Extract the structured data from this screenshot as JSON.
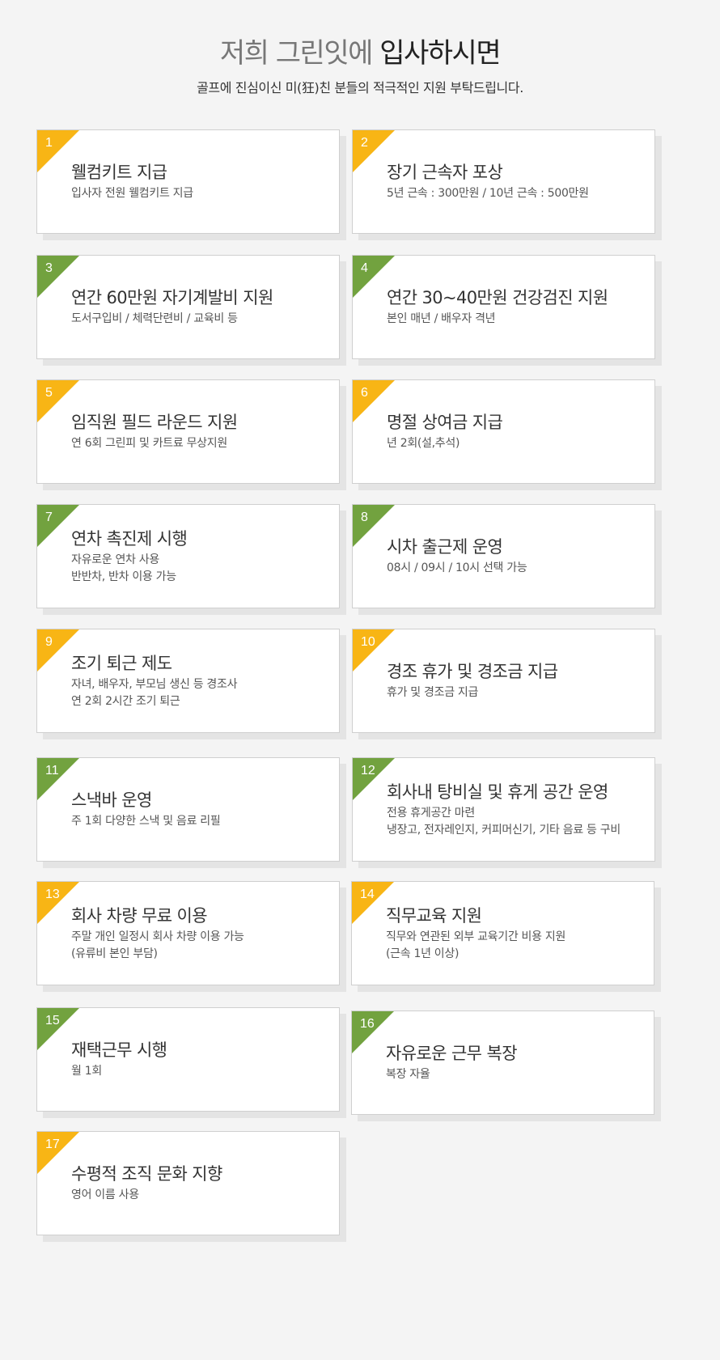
{
  "header": {
    "title_light": "저희 그린잇에",
    "title_bold": "입사하시면",
    "subtitle": "골프에 진심이신 미(狂)친 분들의 적극적인 지원 부탁드립니다."
  },
  "colors": {
    "yellow": "#f8b515",
    "green": "#72a23f"
  },
  "benefits": [
    {
      "num": "1",
      "color": "yellow",
      "title": "웰컴키트 지급",
      "lines": [
        "입사자 전원 웰컴키트 지급"
      ]
    },
    {
      "num": "2",
      "color": "yellow",
      "title": "장기 근속자 포상",
      "lines": [
        "5년 근속 : 300만원 / 10년 근속 : 500만원"
      ]
    },
    {
      "num": "3",
      "color": "green",
      "title": "연간 60만원 자기계발비 지원",
      "lines": [
        "도서구입비 / 체력단련비 / 교육비 등"
      ]
    },
    {
      "num": "4",
      "color": "green",
      "title": "연간 30~40만원 건강검진 지원",
      "lines": [
        "본인 매년 / 배우자 격년"
      ]
    },
    {
      "num": "5",
      "color": "yellow",
      "title": "임직원 필드 라운드 지원",
      "lines": [
        " 연 6회 그린피 및 카트료 무상지원"
      ]
    },
    {
      "num": "6",
      "color": "yellow",
      "title": "명절 상여금 지급",
      "lines": [
        "년 2회(설,추석)"
      ]
    },
    {
      "num": "7",
      "color": "green",
      "title": "연차 촉진제 시행",
      "lines": [
        "자유로운 연차 사용",
        "반반차, 반차 이용 가능"
      ]
    },
    {
      "num": "8",
      "color": "green",
      "title": "시차 출근제 운영",
      "lines": [
        "08시 / 09시 / 10시 선택 가능"
      ]
    },
    {
      "num": "9",
      "color": "yellow",
      "title": "조기 퇴근 제도",
      "lines": [
        " 자녀, 배우자, 부모님 생신 등 경조사",
        " 연 2회 2시간 조기 퇴근"
      ]
    },
    {
      "num": "10",
      "color": "yellow",
      "title": "경조 휴가 및 경조금 지급",
      "lines": [
        "휴가 및 경조금 지급"
      ]
    },
    {
      "num": "11",
      "color": "green",
      "title": "스낵바 운영",
      "lines": [
        "주 1회 다양한 스낵 및 음료 리필"
      ]
    },
    {
      "num": "12",
      "color": "green",
      "title": "회사내 탕비실 및 휴게 공간 운영",
      "lines": [
        "전용 휴게공간 마련",
        "냉장고, 전자레인지, 커피머신기, 기타 음료 등 구비"
      ]
    },
    {
      "num": "13",
      "color": "yellow",
      "title": "회사 차량 무료 이용",
      "lines": [
        "주말 개인 일정시 회사 차량 이용 가능",
        "(유류비 본인 부담)"
      ]
    },
    {
      "num": "14",
      "color": "yellow",
      "title": "직무교육 지원",
      "lines": [
        "직무와 연관된 외부 교육기간 비용 지원",
        "(근속 1년 이상)"
      ]
    },
    {
      "num": "15",
      "color": "green",
      "title": "재택근무 시행",
      "lines": [
        "월 1회"
      ]
    },
    {
      "num": "16",
      "color": "green",
      "title": "자유로운 근무 복장",
      "lines": [
        "복장 자율"
      ]
    },
    {
      "num": "17",
      "color": "yellow",
      "title": "수평적 조직 문화 지향",
      "lines": [
        "영어 이름 사용"
      ]
    }
  ]
}
